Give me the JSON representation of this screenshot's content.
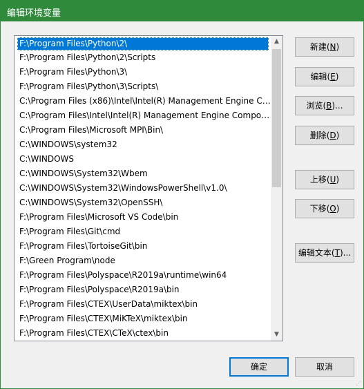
{
  "window": {
    "title": "编辑环境变量"
  },
  "list": {
    "items": [
      "F:\\Program Files\\Python\\2\\",
      "F:\\Program Files\\Python\\2\\Scripts",
      "F:\\Program Files\\Python\\3\\",
      "F:\\Program Files\\Python\\3\\Scripts\\",
      "C:\\Program Files (x86)\\Intel\\Intel(R) Management Engine Co...",
      "C:\\Program Files\\Intel\\Intel(R) Management Engine Compon...",
      "C:\\Program Files\\Microsoft MPI\\Bin\\",
      "C:\\WINDOWS\\system32",
      "C:\\WINDOWS",
      "C:\\WINDOWS\\System32\\Wbem",
      "C:\\WINDOWS\\System32\\WindowsPowerShell\\v1.0\\",
      "C:\\WINDOWS\\System32\\OpenSSH\\",
      "F:\\Program Files\\Microsoft VS Code\\bin",
      "F:\\Program Files\\Git\\cmd",
      "F:\\Program Files\\TortoiseGit\\bin",
      "F:\\Green Program\\node",
      "F:\\Program Files\\Polyspace\\R2019a\\runtime\\win64",
      "F:\\Program Files\\Polyspace\\R2019a\\bin",
      "F:\\Program Files\\CTEX\\UserData\\miktex\\bin",
      "F:\\Program Files\\CTEX\\MiKTeX\\miktex\\bin",
      "F:\\Program Files\\CTEX\\CTeX\\ctex\\bin"
    ]
  },
  "buttons": {
    "new": {
      "label": "新建(",
      "key": "N",
      "tail": ")"
    },
    "edit": {
      "label": "编辑(",
      "key": "E",
      "tail": ")"
    },
    "browse": {
      "label": "浏览(",
      "key": "B",
      "tail": ")..."
    },
    "delete": {
      "label": "删除(",
      "key": "D",
      "tail": ")"
    },
    "move_up": {
      "label": "上移(",
      "key": "U",
      "tail": ")"
    },
    "move_down": {
      "label": "下移(",
      "key": "O",
      "tail": ")"
    },
    "edit_text": {
      "label": "编辑文本(",
      "key": "T",
      "tail": ")..."
    },
    "ok": "确定",
    "cancel": "取消"
  },
  "icons": {
    "scroll_up": "▲",
    "scroll_down": "▼",
    "resize_grip": "⋰"
  }
}
